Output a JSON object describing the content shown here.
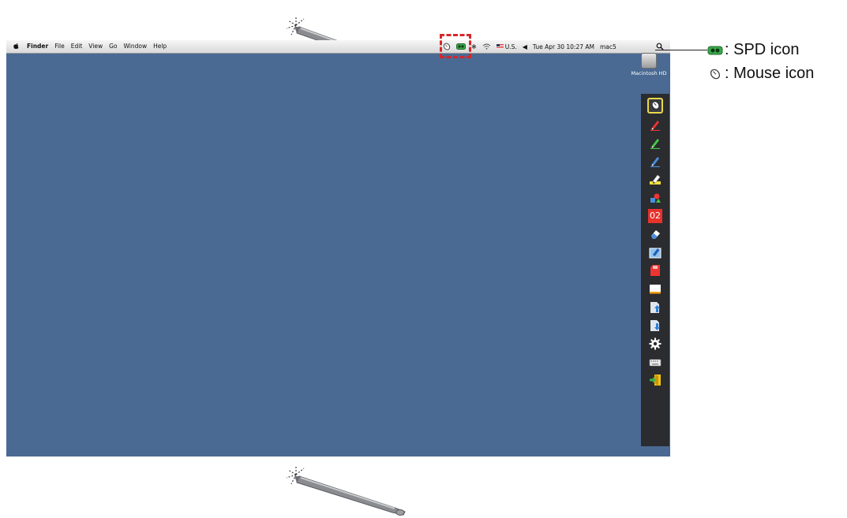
{
  "menubar": {
    "app_name": "Finder",
    "menus": [
      "File",
      "Edit",
      "View",
      "Go",
      "Window",
      "Help"
    ],
    "input_source": "U.S.",
    "clock": "Tue Apr 30  10:27 AM",
    "user": "mac5"
  },
  "desktop": {
    "drive_label": "Macintosh HD",
    "background_color": "#4a6a93"
  },
  "toolbar": {
    "tools": [
      "mouse-icon",
      "red-pen-icon",
      "green-pen-icon",
      "blue-pen-icon",
      "highlighter-icon",
      "shapes-icon",
      "page-counter",
      "eraser-icon",
      "clear-icon",
      "save-icon",
      "whiteboard-icon",
      "import-icon",
      "export-icon",
      "settings-icon",
      "keyboard-icon",
      "exit-icon"
    ],
    "page_counter": "02"
  },
  "legend": {
    "spd": ": SPD icon",
    "mouse": ": Mouse icon"
  },
  "highlight_color": "#d7272b"
}
